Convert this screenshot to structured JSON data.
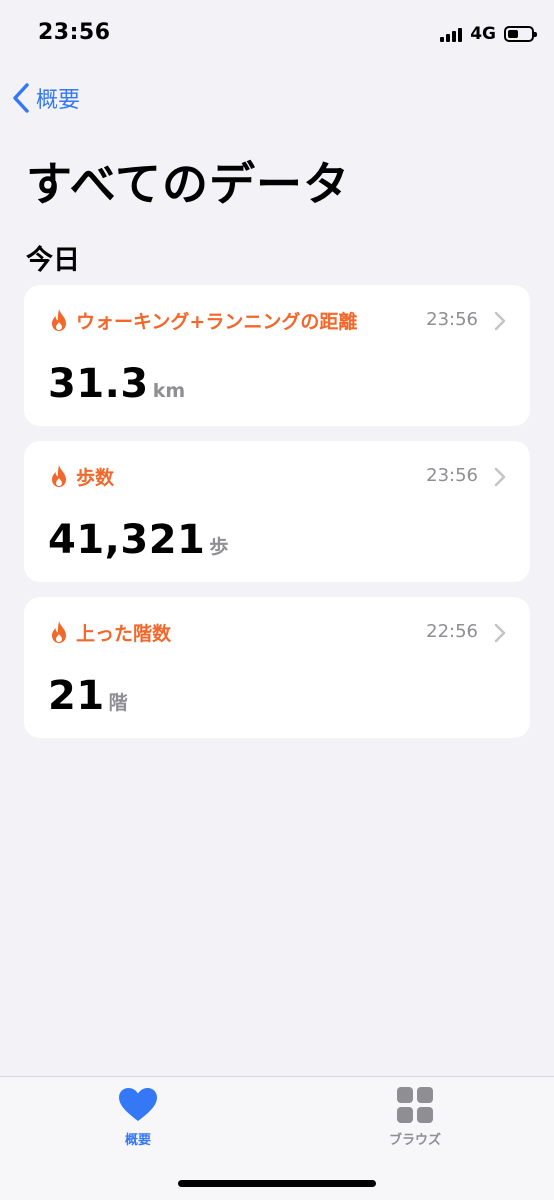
{
  "status_bar": {
    "time": "23:56",
    "network": "4G",
    "battery_level": 0.45
  },
  "nav": {
    "back_label": "概要"
  },
  "page": {
    "title": "すべてのデータ",
    "section_title": "今日"
  },
  "cards": [
    {
      "icon": "flame-icon",
      "label": "ウォーキング+ランニングの距離",
      "time": "23:56",
      "value": "31.3",
      "unit": "km"
    },
    {
      "icon": "flame-icon",
      "label": "歩数",
      "time": "23:56",
      "value": "41,321",
      "unit": "歩"
    },
    {
      "icon": "flame-icon",
      "label": "上った階数",
      "time": "22:56",
      "value": "21",
      "unit": "階"
    }
  ],
  "tab_bar": {
    "tabs": [
      {
        "label": "概要",
        "icon": "heart-icon",
        "selected": true
      },
      {
        "label": "ブラウズ",
        "icon": "grid-icon",
        "selected": false
      }
    ]
  },
  "colors": {
    "accent": "#3478f6",
    "category": "#f3672a",
    "background": "#f2f2f7",
    "secondary_text": "#8e8e93"
  }
}
